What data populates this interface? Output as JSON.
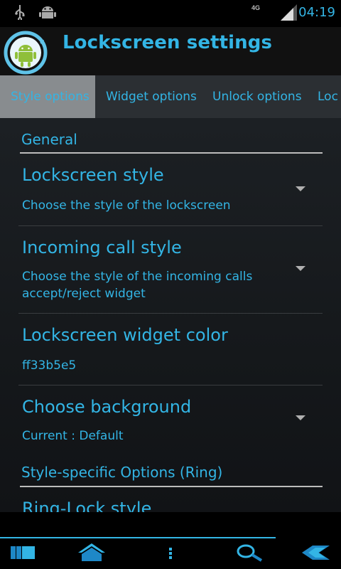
{
  "status_bar": {
    "time": "04:19",
    "network": "4G",
    "icons": [
      "usb-icon",
      "android-debug-icon",
      "signal-icon"
    ]
  },
  "action_bar": {
    "title": "Lockscreen settings",
    "app_icon": "lockscreen-app-icon"
  },
  "tabs": [
    {
      "label": "Style options",
      "active": true
    },
    {
      "label": "Widget options",
      "active": false
    },
    {
      "label": "Unlock options",
      "active": false
    },
    {
      "label": "Loc",
      "active": false
    }
  ],
  "general": {
    "category": "General",
    "items": [
      {
        "title": "Lockscreen style",
        "summary": "Choose the style of the lockscreen"
      },
      {
        "title": "Incoming call style",
        "summary": "Choose the style of the incoming calls accept/reject widget"
      },
      {
        "title": "Lockscreen widget color",
        "summary": "ff33b5e5"
      },
      {
        "title": "Choose background",
        "summary": "Current : Default"
      }
    ]
  },
  "style_specific": {
    "category": "Style-specific Options (Ring)",
    "items": [
      {
        "title": "Ring-Lock style"
      }
    ]
  },
  "bottom_bar": {
    "icons": [
      "books-icon",
      "home-icon",
      "menu-dots-icon",
      "search-icon",
      "back-arrow-icon"
    ]
  },
  "colors": {
    "accent": "#33b5e5",
    "tab_active_bg": "#888c8f",
    "tab_bar_bg": "#2b2f33"
  }
}
